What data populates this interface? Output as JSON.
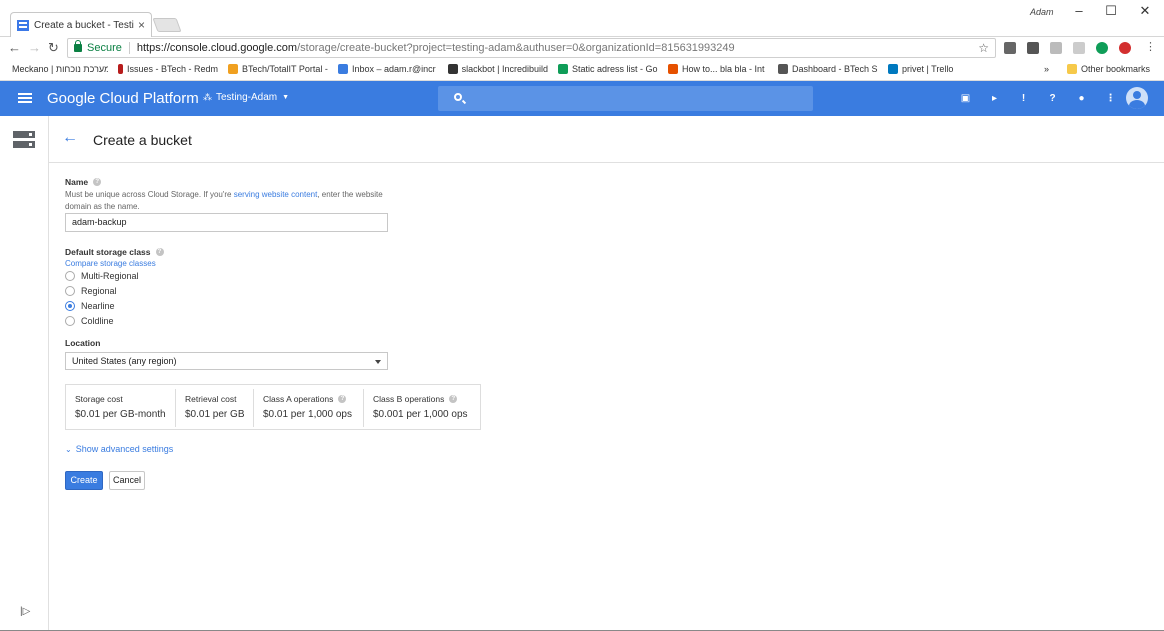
{
  "browser": {
    "tab_title": "Create a bucket - Testing",
    "profile_name": "Adam",
    "secure_label": "Secure",
    "url_host": "https://console.cloud.google.com",
    "url_path": "/storage/create-bucket?project=testing-adam&authuser=0&organizationId=815631993249"
  },
  "bookmarks": [
    {
      "label": "Meckano | מערכת נוכחות",
      "color": "#2d6cdf"
    },
    {
      "label": "Issues - BTech - Redm",
      "color": "#b71c1c"
    },
    {
      "label": "BTech/TotalIT Portal -",
      "color": "#f0a020"
    },
    {
      "label": "Inbox – adam.r@incr",
      "color": "#3a7ce0"
    },
    {
      "label": "slackbot | Incredibuild",
      "color": "#333333"
    },
    {
      "label": "Static adress list - Go",
      "color": "#0f9d58"
    },
    {
      "label": "How to... bla bla - Int",
      "color": "#e65100"
    },
    {
      "label": "Dashboard - BTech S",
      "color": "#555555"
    },
    {
      "label": "privet | Trello",
      "color": "#0079bf"
    }
  ],
  "bookmarks_overflow": "»",
  "other_bookmarks": "Other bookmarks",
  "header": {
    "brand": "Google Cloud Platform",
    "project": "Testing-Adam"
  },
  "page": {
    "title": "Create a bucket"
  },
  "form": {
    "name_label": "Name",
    "name_hint_prefix": "Must be unique across Cloud Storage. If you're ",
    "name_hint_link": "serving website content",
    "name_hint_suffix": ", enter the website domain as the name.",
    "name_value": "adam-backup",
    "storage_class_label": "Default storage class",
    "compare_link": "Compare storage classes",
    "storage_classes": [
      "Multi-Regional",
      "Regional",
      "Nearline",
      "Coldline"
    ],
    "selected_class": "Nearline",
    "location_label": "Location",
    "location_value": "United States (any region)",
    "costs": [
      {
        "label": "Storage cost",
        "value": "$0.01 per GB-month",
        "help": false
      },
      {
        "label": "Retrieval cost",
        "value": "$0.01 per GB",
        "help": false
      },
      {
        "label": "Class A operations",
        "value": "$0.01 per 1,000 ops",
        "help": true
      },
      {
        "label": "Class B operations",
        "value": "$0.001 per 1,000 ops",
        "help": true
      }
    ],
    "advanced_link": "Show advanced settings",
    "create_label": "Create",
    "cancel_label": "Cancel"
  }
}
